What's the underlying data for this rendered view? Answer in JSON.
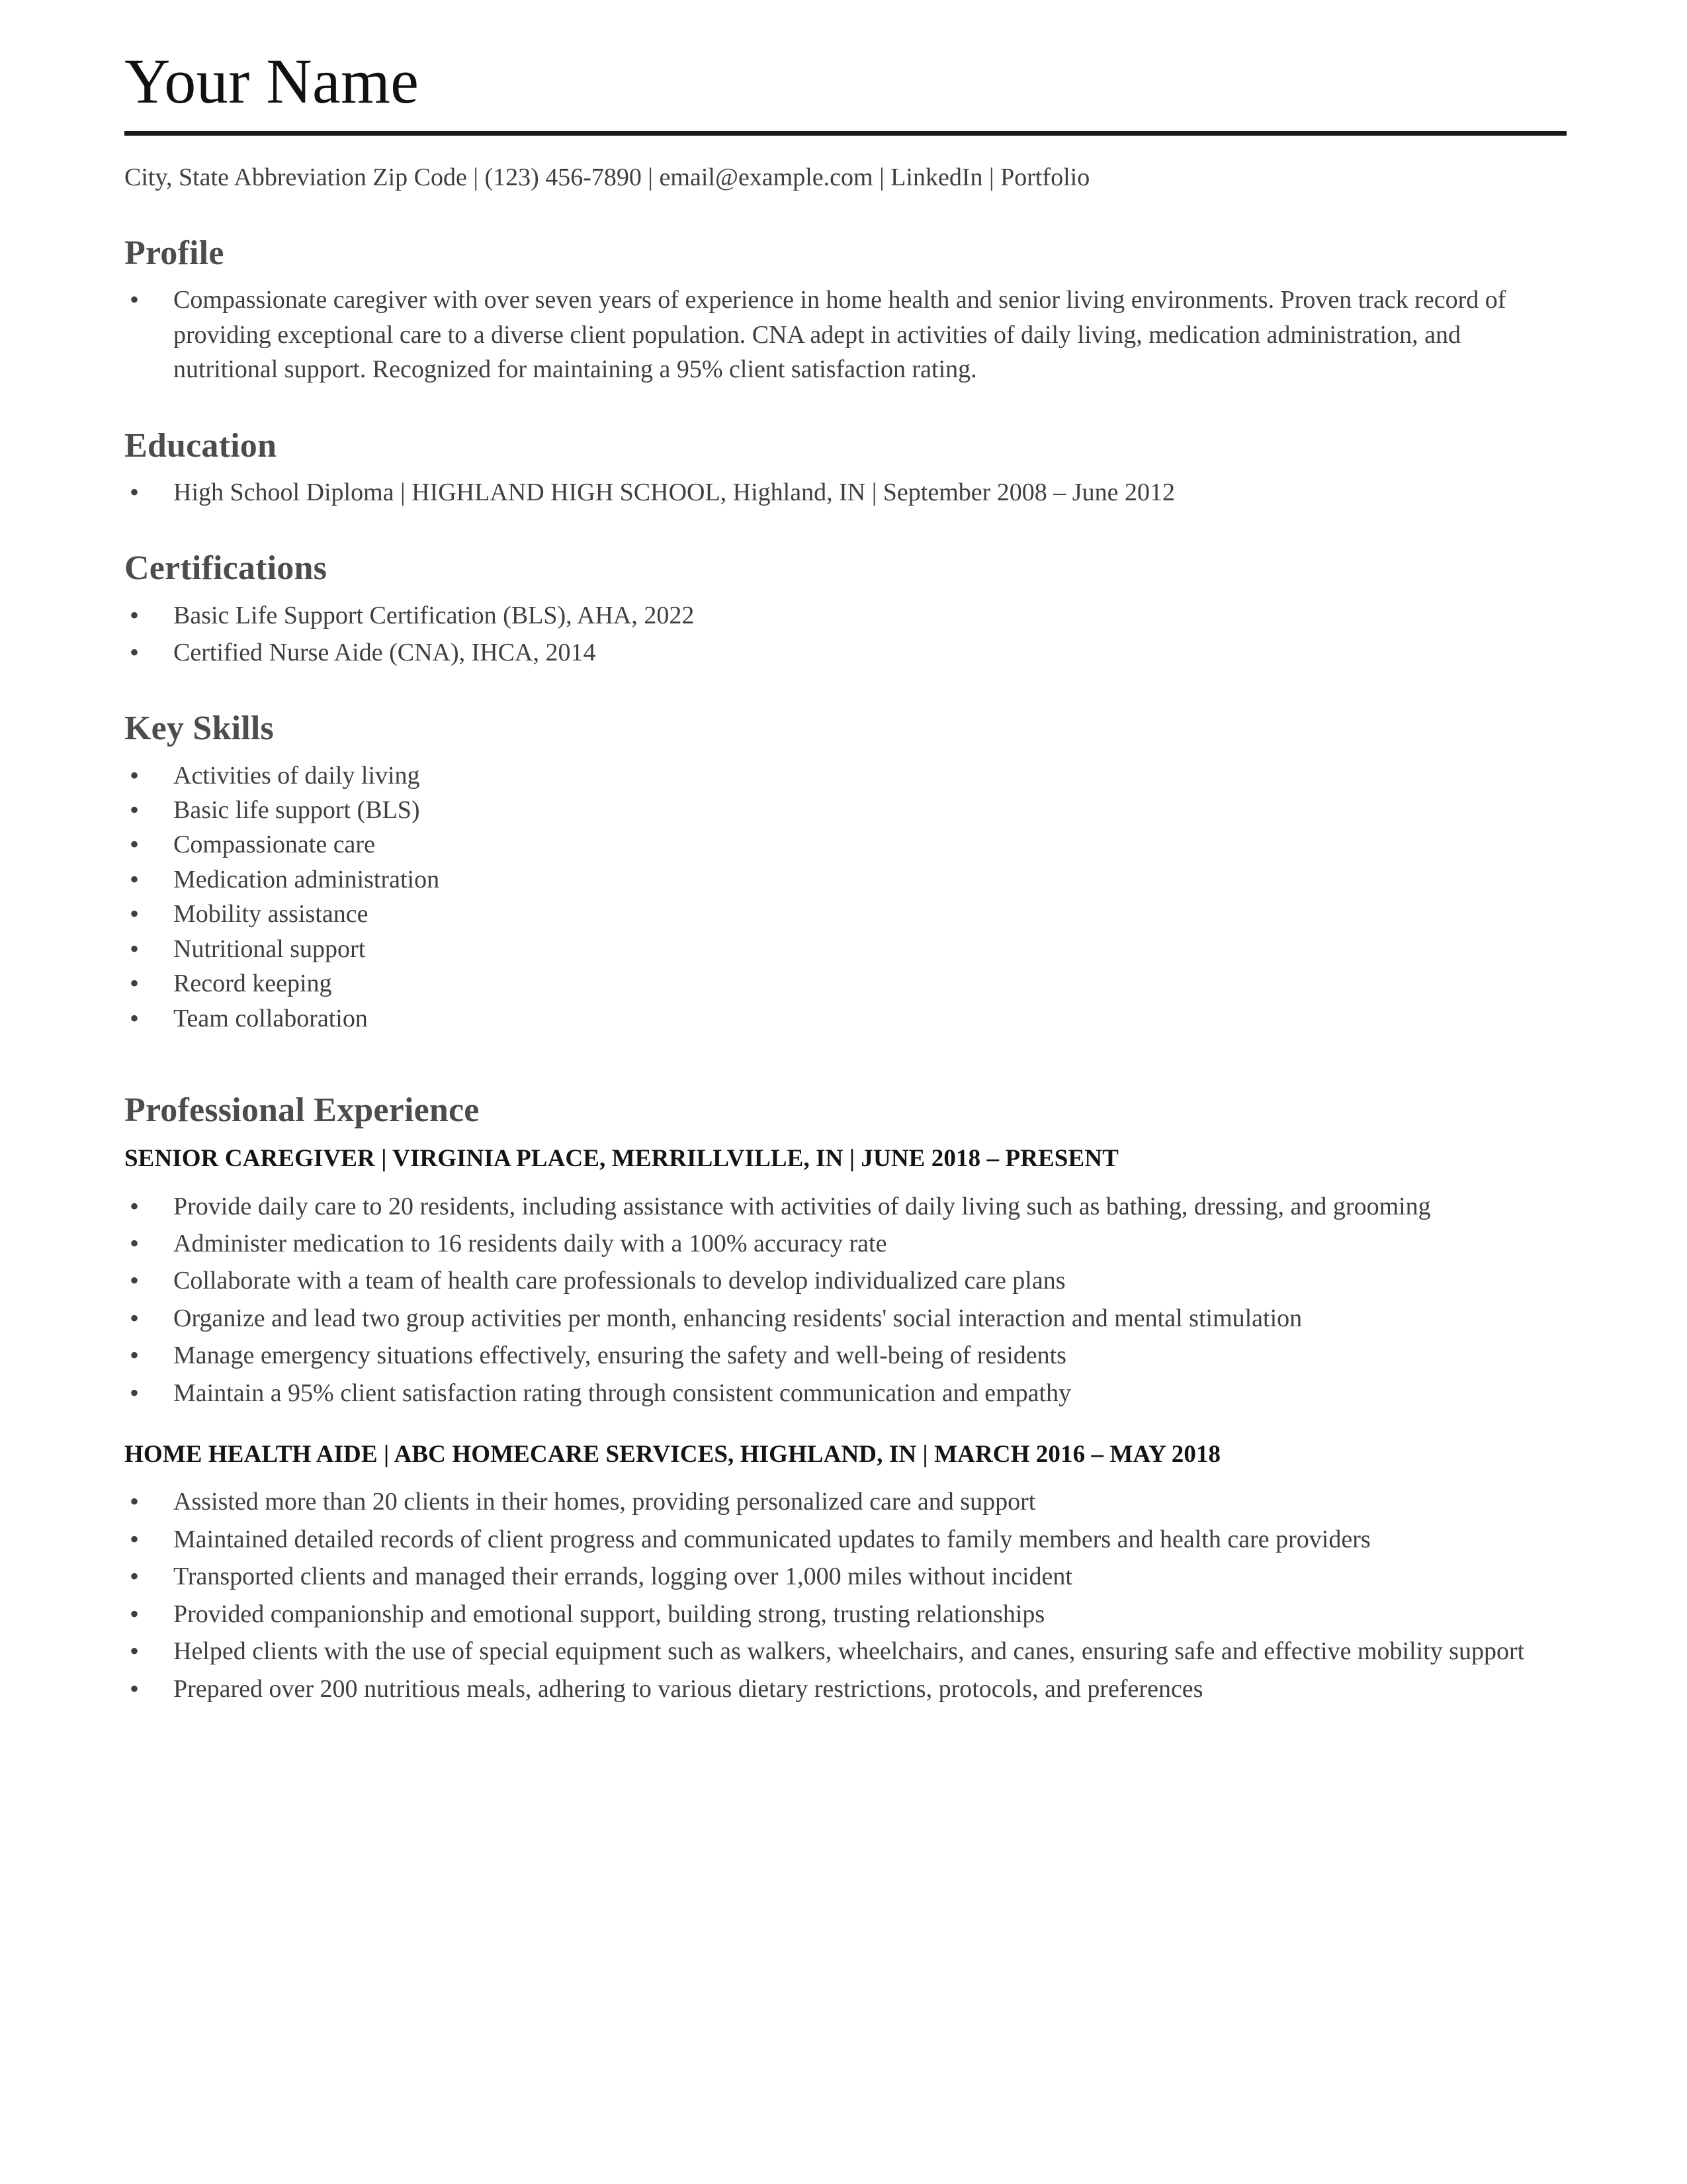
{
  "header": {
    "name": "Your Name",
    "contact": "City, State Abbreviation Zip Code | (123) 456-7890 | email@example.com | LinkedIn | Portfolio"
  },
  "sections": {
    "profile": {
      "title": "Profile",
      "items": [
        "Compassionate caregiver with over seven years of experience in home health and senior living environments. Proven track record of providing exceptional care to a diverse client population. CNA adept in activities of daily living, medication administration, and nutritional support. Recognized for maintaining a 95% client satisfaction rating."
      ]
    },
    "education": {
      "title": "Education",
      "items": [
        "High School Diploma | HIGHLAND HIGH SCHOOL, Highland, IN | September 2008 – June 2012"
      ]
    },
    "certifications": {
      "title": "Certifications",
      "items": [
        "Basic Life Support Certification (BLS), AHA, 2022",
        "Certified Nurse Aide (CNA), IHCA, 2014"
      ]
    },
    "key_skills": {
      "title": "Key Skills",
      "items": [
        "Activities of daily living",
        "Basic life support (BLS)",
        "Compassionate care",
        "Medication administration",
        "Mobility assistance",
        "Nutritional support",
        "Record keeping",
        "Team collaboration"
      ]
    },
    "experience": {
      "title": "Professional Experience",
      "jobs": [
        {
          "heading": "SENIOR CAREGIVER | VIRGINIA PLACE, MERRILLVILLE, IN | JUNE 2018 – PRESENT",
          "items": [
            "Provide daily care to 20 residents, including assistance with activities of daily living such as bathing, dressing, and grooming",
            "Administer medication to 16 residents daily with a 100% accuracy rate",
            "Collaborate with a team of health care professionals to develop individualized care plans",
            "Organize and lead two group activities per month, enhancing residents' social interaction and mental stimulation",
            "Manage emergency situations effectively, ensuring the safety and well-being of residents",
            "Maintain a 95% client satisfaction rating through consistent communication and empathy"
          ]
        },
        {
          "heading": "HOME HEALTH AIDE | ABC HOMECARE SERVICES, HIGHLAND, IN | MARCH 2016 – MAY 2018",
          "items": [
            "Assisted more than 20 clients in their homes, providing personalized care and support",
            "Maintained detailed records of client progress and communicated updates to family members and health care providers",
            "Transported clients and managed their errands, logging over 1,000 miles without incident",
            "Provided companionship and emotional support, building strong, trusting relationships",
            "Helped clients with the use of special equipment such as walkers, wheelchairs, and canes, ensuring safe and effective mobility support",
            "Prepared over 200 nutritious meals, adhering to various dietary restrictions, protocols, and preferences"
          ]
        }
      ]
    }
  }
}
